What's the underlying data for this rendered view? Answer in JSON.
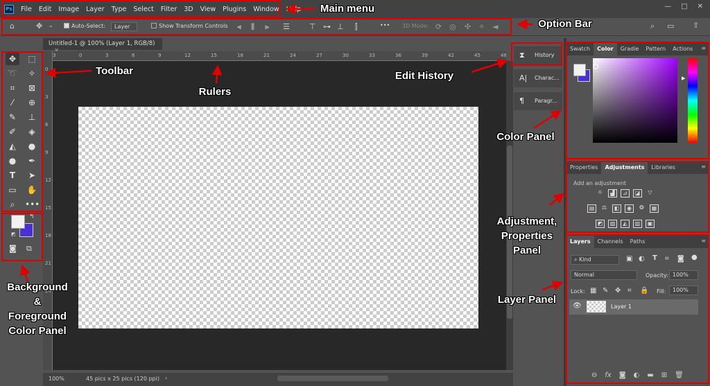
{
  "app": {
    "logo": "Ps"
  },
  "menu": [
    "File",
    "Edit",
    "Image",
    "Layer",
    "Type",
    "Select",
    "Filter",
    "3D",
    "View",
    "Plugins",
    "Window",
    "Help"
  ],
  "window_controls": [
    "—",
    "□",
    "✕"
  ],
  "option_bar": {
    "auto_select_label": "Auto-Select:",
    "auto_select_value": "Layer",
    "show_transform_label": "Show Transform Controls",
    "more": "•••",
    "mode_3d": "3D Mode:"
  },
  "document": {
    "tab_title": "Untitled-1 @ 100% (Layer 1, RGB/8)",
    "tab_close": "×"
  },
  "ruler": {
    "h_ticks": [
      "3",
      "0",
      "3",
      "6",
      "9",
      "12",
      "15",
      "18",
      "21",
      "24",
      "27",
      "30",
      "33",
      "36",
      "39",
      "42",
      "45",
      "48"
    ],
    "v_ticks": [
      "0",
      "3",
      "6",
      "9",
      "12",
      "15",
      "18",
      "21",
      "24"
    ]
  },
  "status": {
    "zoom": "100%",
    "doc_size": "45 pics x 25 pics (120 ppi)",
    "arrow": "›"
  },
  "collapsed_panels": [
    {
      "label": "History",
      "icon": "history-icon"
    },
    {
      "label": "Charac...",
      "icon": "character-icon"
    },
    {
      "label": "Paragr...",
      "icon": "paragraph-icon"
    }
  ],
  "color_panel": {
    "tabs": [
      "Swatch",
      "Color",
      "Gradie",
      "Pattern",
      "Actions"
    ],
    "active_tab": "Color",
    "foreground": "#f2f2f2",
    "background": "#4b2fd6"
  },
  "adjust_panel": {
    "tabs": [
      "Properties",
      "Adjustments",
      "Libraries"
    ],
    "active_tab": "Adjustments",
    "hint": "Add an adjustment"
  },
  "layers_panel": {
    "tabs": [
      "Layers",
      "Channels",
      "Paths"
    ],
    "active_tab": "Layers",
    "filter": "Kind",
    "blend_mode": "Normal",
    "opacity_label": "Opacity:",
    "opacity": "100%",
    "lock_label": "Lock:",
    "fill_label": "Fill:",
    "fill": "100%",
    "layers": [
      {
        "name": "Layer 1",
        "visible": true
      }
    ],
    "footer_icons": [
      "link-icon",
      "fx-icon",
      "mask-icon",
      "adjustment-layer-icon",
      "group-folder-icon",
      "new-layer-icon",
      "trash-icon"
    ]
  },
  "annotations": {
    "main_menu": "Main menu",
    "option_bar": "Option Bar",
    "toolbar": "Toolbar",
    "rulers": "Rulers",
    "edit_history": "Edit History",
    "color_panel": "Color Panel",
    "adjustment": "Adjustment,\nProperties\nPanel",
    "layer_panel": "Layer Panel",
    "bg_fg": "Background\n&\nForeground\nColor Panel"
  },
  "accent": "#e00000"
}
